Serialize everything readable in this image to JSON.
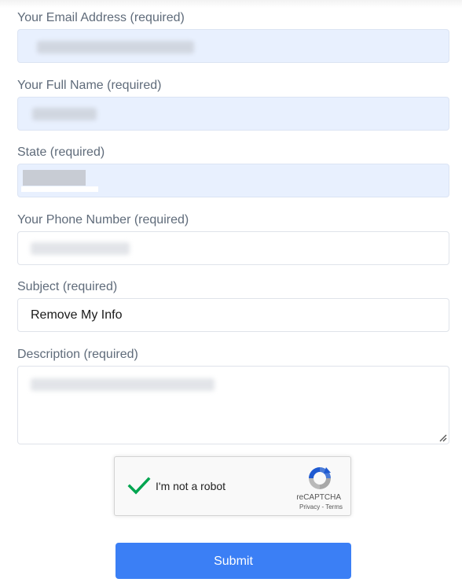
{
  "form": {
    "fields": [
      {
        "label": "Your Email Address (required)",
        "type": "text",
        "value": "",
        "autofilled": true,
        "redacted": true
      },
      {
        "label": "Your Full Name (required)",
        "type": "text",
        "value": "",
        "autofilled": true,
        "redacted": true
      },
      {
        "label": "State (required)",
        "type": "text",
        "value": "",
        "autofilled": true,
        "redacted": true
      },
      {
        "label": "Your Phone Number (required)",
        "type": "text",
        "value": "",
        "autofilled": false,
        "redacted": true
      },
      {
        "label": "Subject (required)",
        "type": "text",
        "value": "Remove My Info",
        "autofilled": false,
        "redacted": false
      },
      {
        "label": "Description (required)",
        "type": "textarea",
        "value": "",
        "autofilled": false,
        "redacted": true
      }
    ],
    "submit_label": "Submit"
  },
  "captcha": {
    "label": "I'm not a robot",
    "checked": true,
    "brand": "reCAPTCHA",
    "privacy_link": "Privacy",
    "separator": " - ",
    "terms_link": "Terms",
    "check_color": "#00a550"
  },
  "colors": {
    "autofill_bg": "#e8f0fe",
    "label_text": "#5f6b7a",
    "submit_bg": "#3b7ff5"
  }
}
